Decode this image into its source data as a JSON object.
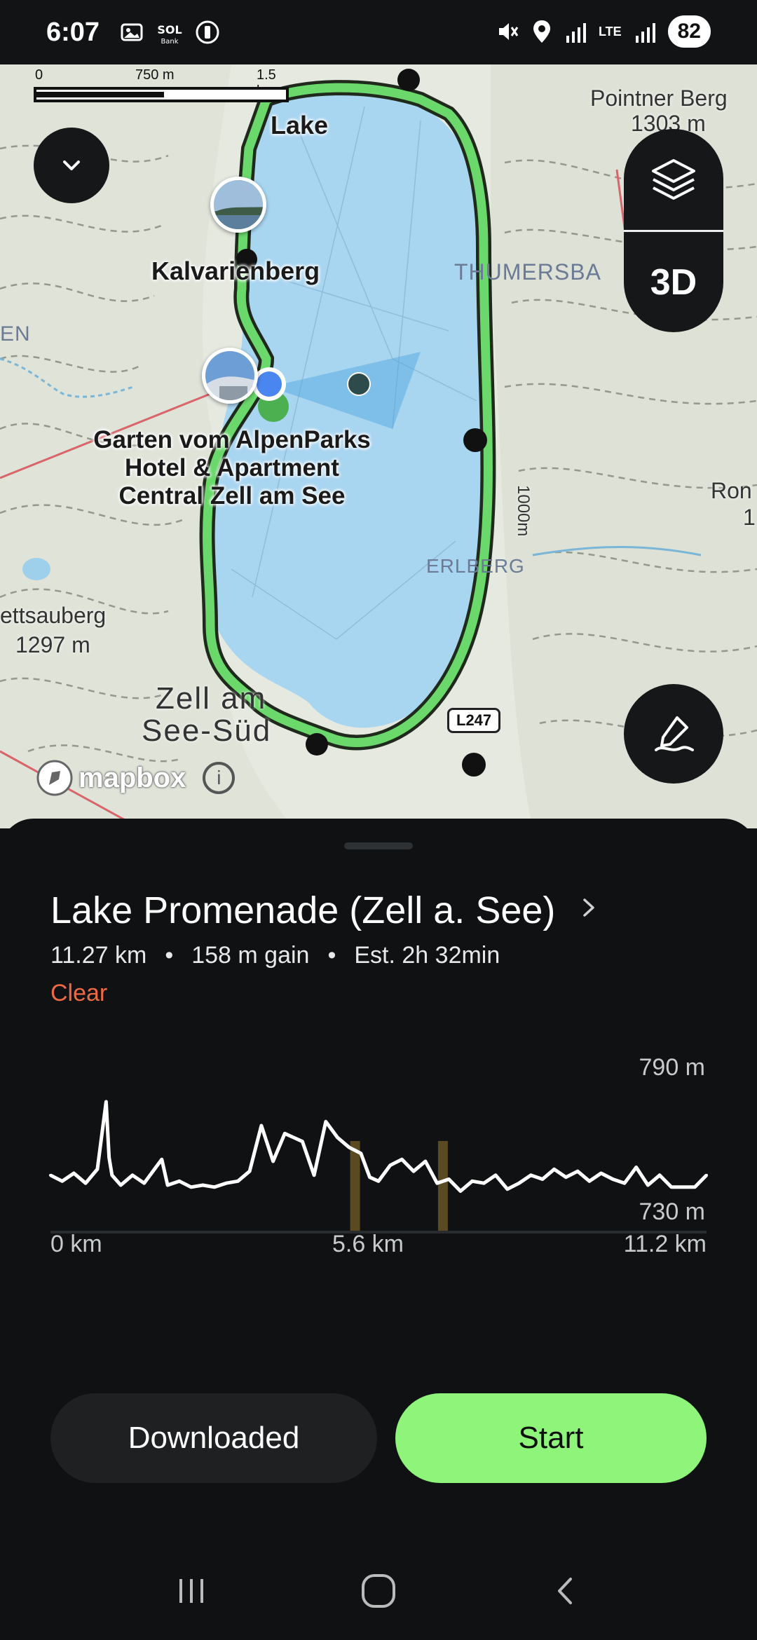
{
  "status_bar": {
    "time": "6:07",
    "network": "LTE",
    "battery": "82"
  },
  "map": {
    "scale": {
      "start": "0",
      "mid": "750 m",
      "end": "1.5 km"
    },
    "labels": {
      "lake": "Lake",
      "kalvarienberg": "Kalvarienberg",
      "hotel_line1": "Garten vom AlpenParks",
      "hotel_line2": "Hotel & Apartment",
      "hotel_line3": "Central Zell am See",
      "pointner": "Pointner Berg",
      "pointner_elev": "1303 m",
      "thumersbach": "THUMERSBA",
      "erlberg": "ERLBERG",
      "en": "EN",
      "ettsauberg": "ettsauberg",
      "ettsauberg_elev": "1297 m",
      "zell_line1": "Zell am",
      "zell_line2": "See-Süd",
      "contour": "1000m",
      "ron": "Ron",
      "ron_elev": "1",
      "road": "L247",
      "attribution": "mapbox"
    },
    "buttons": {
      "three_d": "3D"
    }
  },
  "route": {
    "title": "Lake Promenade (Zell a. See)",
    "distance": "11.27 km",
    "gain": "158 m gain",
    "estimate": "Est. 2h 32min",
    "separator": "•",
    "weather": "Clear"
  },
  "chart_data": {
    "type": "line",
    "title": "",
    "xlabel": "",
    "ylabel": "",
    "ylim": [
      730,
      790
    ],
    "xlim": [
      0,
      11.2
    ],
    "y_axis_labels": [
      "790 m",
      "730 m"
    ],
    "x_axis_labels": [
      "0 km",
      "5.6 km",
      "11.2 km"
    ],
    "series": [
      {
        "x": [
          0,
          0.2,
          0.4,
          0.6,
          0.8,
          0.95,
          1.0,
          1.05,
          1.2,
          1.4,
          1.6,
          1.8,
          1.9,
          2.0,
          2.2,
          2.4,
          2.6,
          2.8,
          3.0,
          3.2,
          3.4,
          3.6,
          3.8,
          4.0,
          4.15,
          4.3,
          4.5,
          4.7,
          4.9,
          5.1,
          5.3,
          5.45,
          5.6,
          5.8,
          6.0,
          6.2,
          6.4,
          6.6,
          6.8,
          7.0,
          7.2,
          7.4,
          7.6,
          7.8,
          8.0,
          8.2,
          8.4,
          8.6,
          8.8,
          9.0,
          9.2,
          9.4,
          9.6,
          9.8,
          10.0,
          10.2,
          10.4,
          10.6,
          10.8,
          11.0,
          11.2
        ],
        "y": [
          741,
          738,
          742,
          737,
          744,
          778,
          750,
          741,
          736,
          741,
          737,
          745,
          749,
          736,
          738,
          735,
          736,
          735,
          737,
          738,
          743,
          766,
          748,
          762,
          760,
          758,
          741,
          768,
          760,
          755,
          752,
          740,
          738,
          746,
          749,
          743,
          748,
          737,
          739,
          733,
          738,
          737,
          741,
          734,
          737,
          741,
          739,
          744,
          740,
          743,
          738,
          742,
          739,
          737,
          745,
          736,
          741,
          735,
          735,
          735,
          741
        ]
      }
    ],
    "markers_km": [
      5.2,
      6.7
    ]
  },
  "actions": {
    "downloaded": "Downloaded",
    "start": "Start"
  }
}
